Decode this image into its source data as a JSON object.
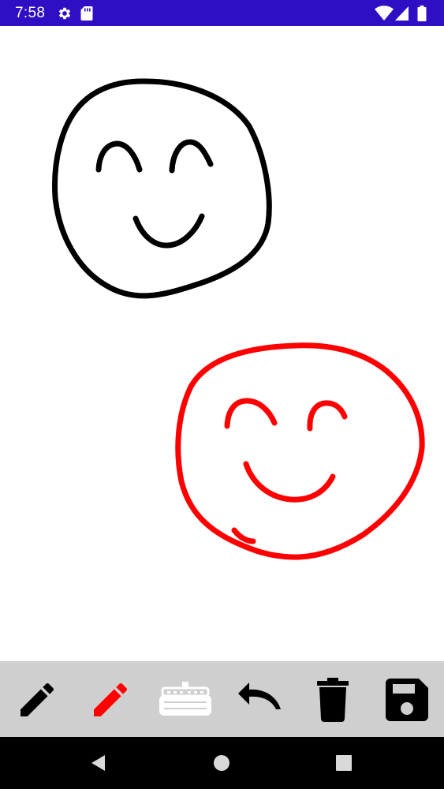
{
  "status_bar": {
    "time": "7:58",
    "background": "#2f0ec3",
    "left_icons": [
      "settings-gear-icon",
      "sd-card-icon"
    ],
    "right_icons": [
      "wifi-icon",
      "cellular-signal-icon",
      "battery-icon"
    ]
  },
  "canvas": {
    "background": "#ffffff",
    "drawings": [
      {
        "name": "smiley-face",
        "stroke_color": "#000000"
      },
      {
        "name": "smiley-face",
        "stroke_color": "#ff0000"
      }
    ]
  },
  "toolbar": {
    "background": "#cfcfcf",
    "tools": [
      {
        "id": "pencil-black",
        "icon": "pencil-icon",
        "color": "#000000"
      },
      {
        "id": "pencil-red",
        "icon": "pencil-icon",
        "color": "#ff0000"
      },
      {
        "id": "color-palette",
        "icon": "paint-palette-icon",
        "color": "#ffffff"
      },
      {
        "id": "undo",
        "icon": "undo-icon",
        "color": "#000000"
      },
      {
        "id": "delete",
        "icon": "trash-icon",
        "color": "#000000"
      },
      {
        "id": "save",
        "icon": "floppy-disk-icon",
        "color": "#000000"
      }
    ]
  },
  "navigation_bar": {
    "background": "#000000",
    "buttons": [
      "back-icon",
      "home-icon",
      "recents-icon"
    ]
  }
}
